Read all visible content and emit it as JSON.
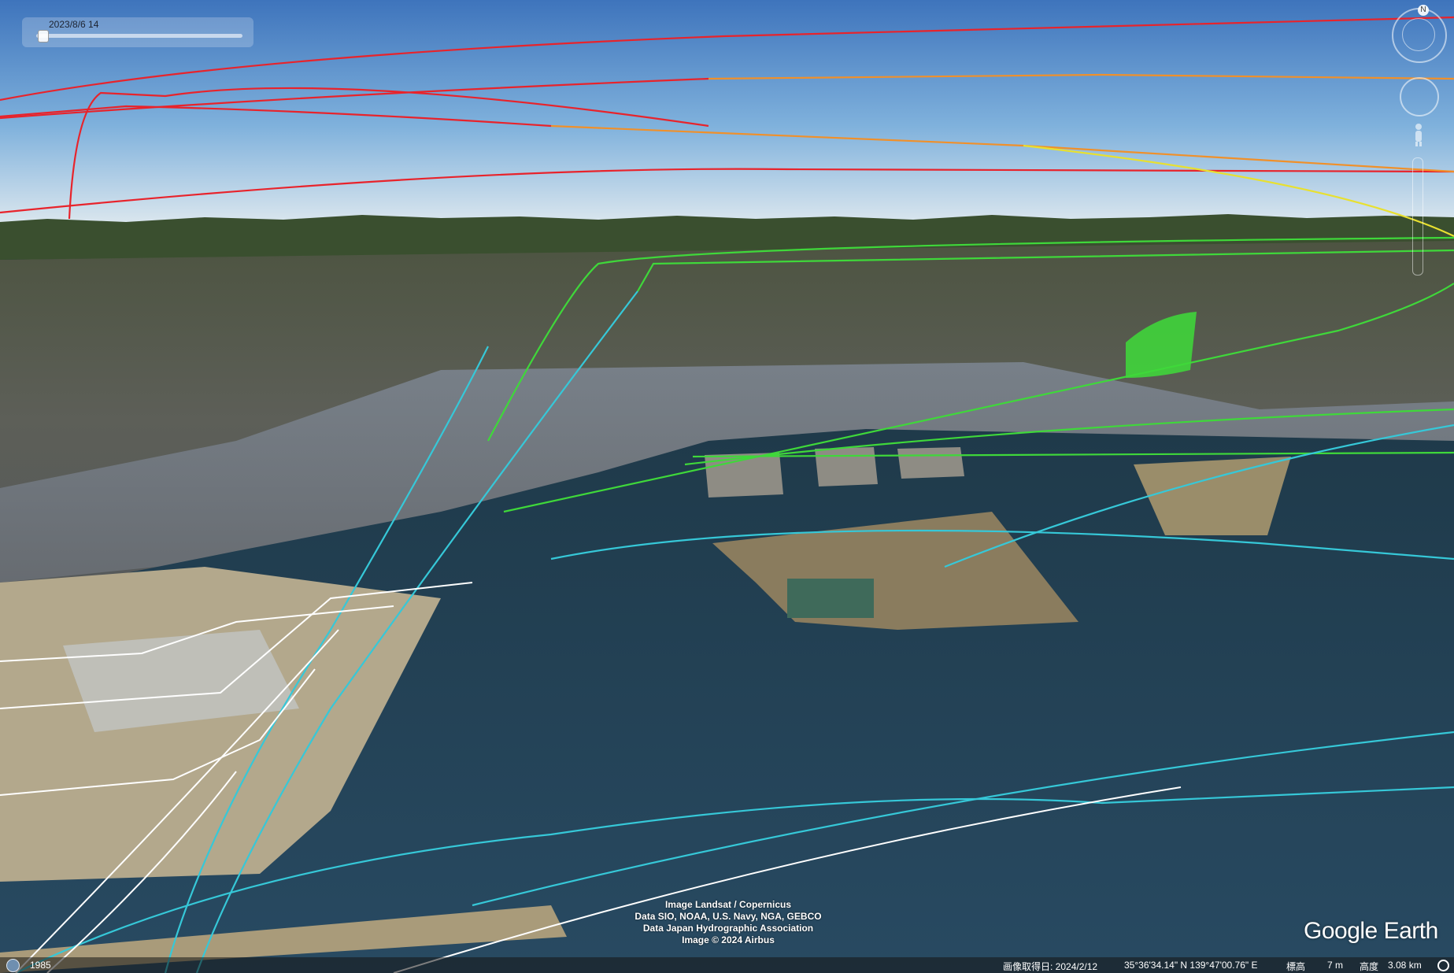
{
  "time_slider": {
    "label": "2023/8/6 14",
    "position": 0.03
  },
  "attribution": [
    "Image Landsat / Copernicus",
    "Data SIO, NOAA, U.S. Navy, NGA, GEBCO",
    "Data Japan Hydrographic Association",
    "Image © 2024 Airbus"
  ],
  "logo": "Google Earth",
  "status_bar": {
    "year": "1985",
    "imagery_date": "画像取得日: 2024/2/12",
    "coordinates": "35°36'34.14\" N   139°47'00.76\" E",
    "elevation_label": "標高",
    "elevation_value": "7 m",
    "eye_label": "高度",
    "eye_value": "3.08 km"
  },
  "icons": {
    "north": "north-arrow-icon",
    "look": "look-joystick-icon",
    "person": "street-view-person-icon",
    "historical": "historical-imagery-icon",
    "stream": "streaming-progress-icon"
  },
  "colors": {
    "sky_top": "#3f78bf",
    "sky_horizon": "#dde8ee",
    "bay": "#233f52",
    "track_red": "#e8232b",
    "track_orange": "#f0902a",
    "track_yellow": "#e8e030",
    "track_green": "#3fd83a",
    "track_cyan": "#36c8d8",
    "track_white": "#ffffff"
  }
}
